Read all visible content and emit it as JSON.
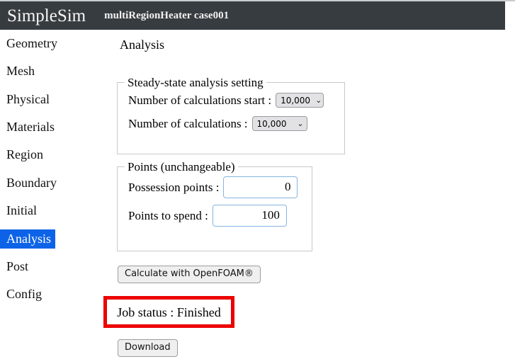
{
  "header": {
    "app_title": "SimpleSim",
    "case_label": "multiRegionHeater case001"
  },
  "sidebar": {
    "items": [
      {
        "label": "Geometry",
        "active": false
      },
      {
        "label": "Mesh",
        "active": false
      },
      {
        "label": "Physical",
        "active": false
      },
      {
        "label": "Materials",
        "active": false
      },
      {
        "label": "Region",
        "active": false
      },
      {
        "label": "Boundary",
        "active": false
      },
      {
        "label": "Initial",
        "active": false
      },
      {
        "label": "Analysis",
        "active": true
      },
      {
        "label": "Post",
        "active": false
      },
      {
        "label": "Config",
        "active": false
      }
    ]
  },
  "main": {
    "page_title": "Analysis",
    "steady_state": {
      "legend": "Steady-state analysis setting",
      "calc_start_label": "Number of calculations start :",
      "calc_start_value": "10,000",
      "calc_total_label": "Number of calculations :",
      "calc_total_value": "10,000",
      "chevron_icon": "⌄"
    },
    "points": {
      "legend": "Points (unchangeable)",
      "possession_label": "Possession points :",
      "possession_value": "0",
      "spend_label": "Points to spend :",
      "spend_value": "100"
    },
    "calculate_button_label": "Calculate with OpenFOAM®",
    "job_status_text": "Job status : Finished",
    "download_button_label": "Download"
  },
  "colors": {
    "header_bg": "#373c40",
    "sidebar_active_bg": "#0d63e8",
    "annotation_red": "#ec0000",
    "input_border_blue": "#85b4df"
  }
}
